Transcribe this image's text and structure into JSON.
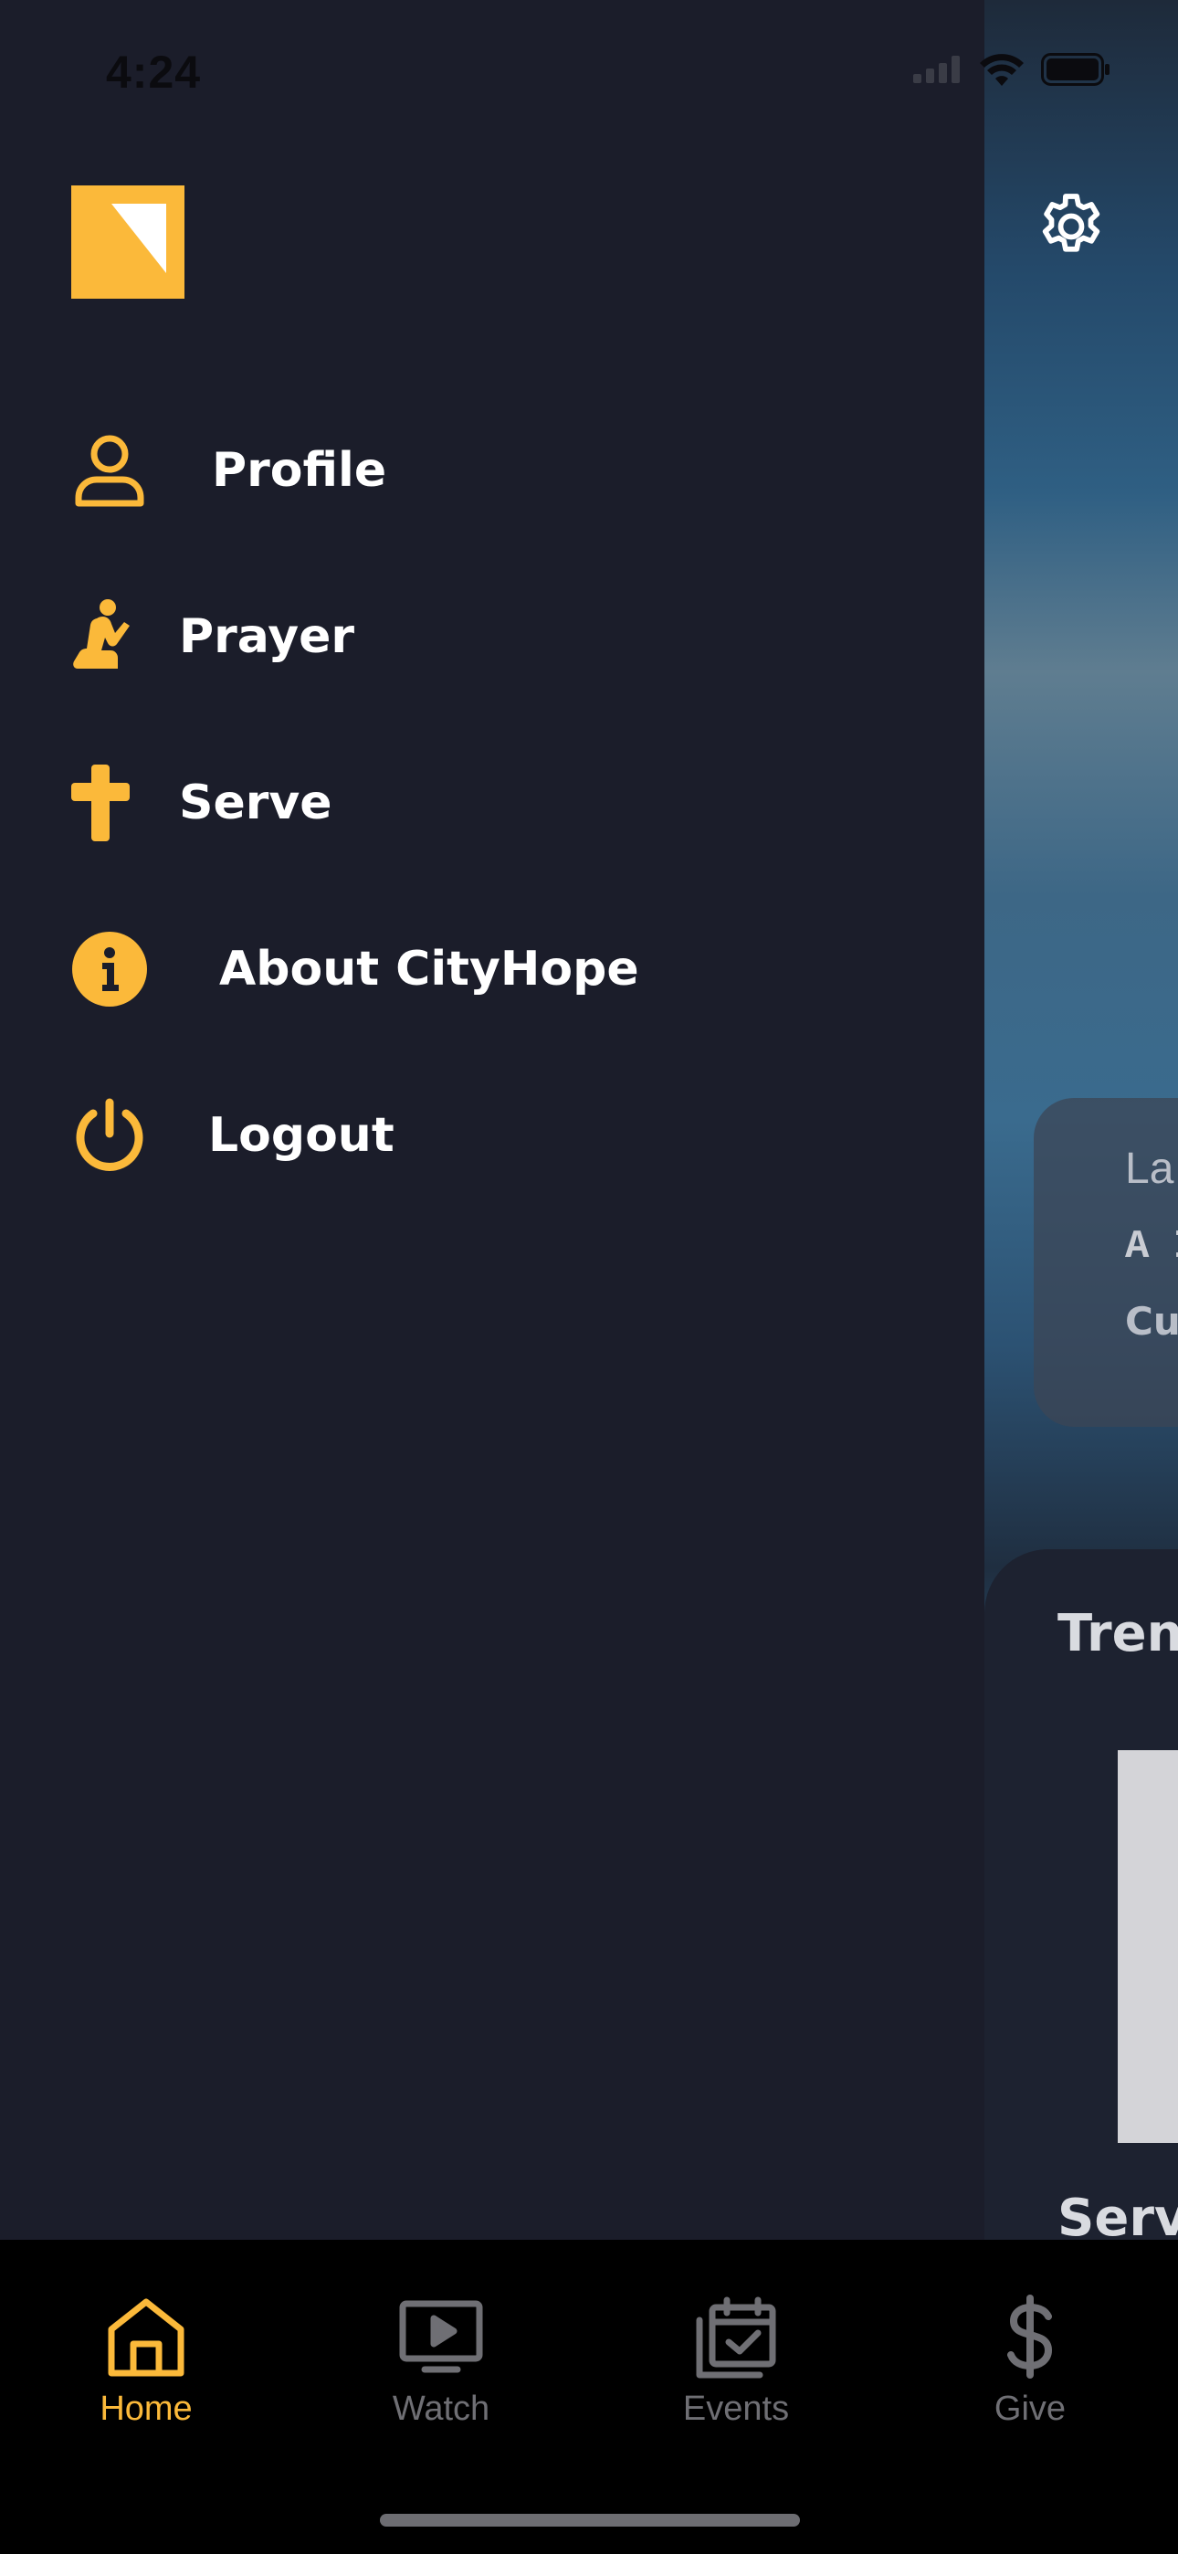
{
  "status_bar": {
    "time": "4:24"
  },
  "drawer": {
    "menu": [
      {
        "label": "Profile",
        "icon": "profile-icon"
      },
      {
        "label": "Prayer",
        "icon": "prayer-icon"
      },
      {
        "label": "Serve",
        "icon": "cross-icon"
      },
      {
        "label": "About CityHope",
        "icon": "info-icon"
      },
      {
        "label": "Logout",
        "icon": "power-icon"
      }
    ]
  },
  "background": {
    "latest_card": {
      "line1": "La",
      "line2": "A I",
      "line3": "Cu"
    },
    "trending_title": "Trenc",
    "services_title": "Servi"
  },
  "tabbar": {
    "tabs": [
      {
        "label": "Home",
        "icon": "home-icon",
        "active": true
      },
      {
        "label": "Watch",
        "icon": "play-icon",
        "active": false
      },
      {
        "label": "Events",
        "icon": "calendar-icon",
        "active": false
      },
      {
        "label": "Give",
        "icon": "dollar-icon",
        "active": false
      }
    ]
  },
  "colors": {
    "accent": "#fbb93a",
    "drawer_bg": "#1b1d2a",
    "tabbar_bg": "#000000",
    "inactive_tab": "#6f6f74"
  }
}
